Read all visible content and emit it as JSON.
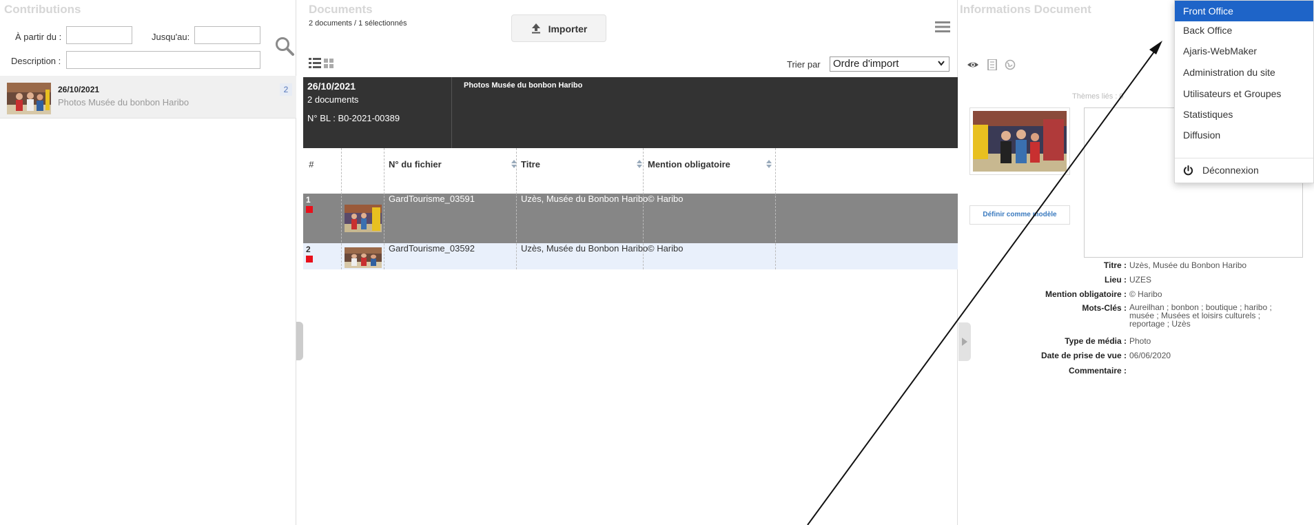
{
  "contributions": {
    "title": "Contributions",
    "from_label": "À partir du :",
    "to_label": "Jusqu'au:",
    "description_label": "Description :",
    "from_value": "",
    "to_value": "",
    "description_value": "",
    "item": {
      "date": "26/10/2021",
      "description": "Photos Musée du bonbon Haribo",
      "count": "2"
    }
  },
  "documents": {
    "title": "Documents",
    "subtitle": "2 documents / 1 sélectionnés",
    "import_label": "Importer",
    "sort_label": "Trier par",
    "sort_value": "Ordre d'import",
    "batch": {
      "date": "26/10/2021",
      "count": "2 documents",
      "bl": "N° BL :  B0-2021-00389",
      "description": "Photos Musée du bonbon Haribo"
    },
    "columns": [
      "#",
      "N° du fichier",
      "Titre",
      "Mention obligatoire"
    ],
    "rows": [
      {
        "num": "1",
        "file": "GardTourisme_03591",
        "title": "Uzès, Musée du Bonbon Haribo",
        "mention": "© Haribo",
        "selected": true
      },
      {
        "num": "2",
        "file": "GardTourisme_03592",
        "title": "Uzès, Musée du Bonbon Haribo",
        "mention": "© Haribo",
        "selected": false
      }
    ]
  },
  "info": {
    "title": "Informations Document",
    "themes": "Thèmes liés : 0",
    "define_model": "Définir comme modèle",
    "fields": [
      {
        "label": "Titre :",
        "value": "Uzès, Musée du Bonbon Haribo"
      },
      {
        "label": "Lieu :",
        "value": "UZES"
      },
      {
        "label": "Mention obligatoire :",
        "value": "© Haribo"
      },
      {
        "label": "Mots-Clés :",
        "value_lines": [
          "Aureilhan ; bonbon ; boutique ; haribo ;",
          "musée ; Musées et loisirs culturels ;",
          "reportage ; Uzès"
        ]
      },
      {
        "label": "Type de média :",
        "value": "Photo"
      },
      {
        "label": "Date de prise de vue :",
        "value": "06/06/2020"
      },
      {
        "label": "Commentaire :",
        "value": ""
      }
    ]
  },
  "menu": {
    "items": [
      "Front Office",
      "Back Office",
      "Ajaris-WebMaker",
      "Administration du site",
      "Utilisateurs et Groupes",
      "Statistiques",
      "Diffusion"
    ],
    "active": "Front Office",
    "logout": "Déconnexion"
  },
  "colors": {
    "accent": "#1e64c8",
    "selected_row": "#868686",
    "batch_header": "#333333",
    "flag": "#e8101b"
  }
}
